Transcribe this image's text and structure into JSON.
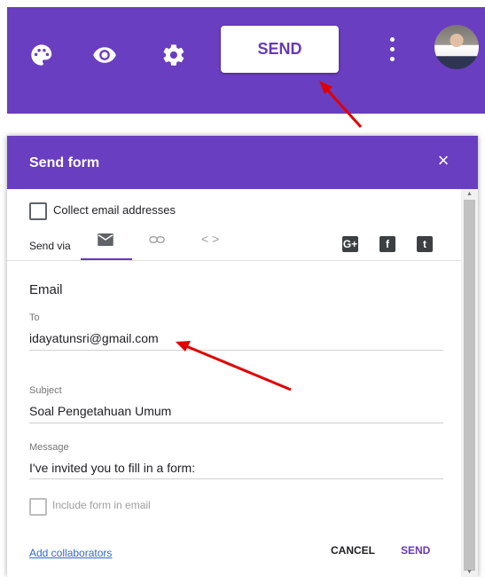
{
  "toolbar": {
    "send_label": "SEND",
    "icons": [
      "palette-icon",
      "eye-icon",
      "gear-icon",
      "more-vert-icon",
      "avatar"
    ],
    "background": "#6a3ec0"
  },
  "dialog": {
    "title": "Send form",
    "close": "×",
    "collect_email_label": "Collect email addresses",
    "send_via_label": "Send via",
    "tabs": [
      "mail-icon",
      "link-icon",
      "embed-icon"
    ],
    "social": {
      "gplus": "G+",
      "facebook": "f",
      "twitter": "t"
    },
    "section_title": "Email",
    "to_label": "To",
    "to_value": "idayatunsri@gmail.com",
    "subject_label": "Subject",
    "subject_value": "Soal Pengetahuan Umum",
    "message_label": "Message",
    "message_value": "I've invited you to fill in a form:",
    "include_form_label": "Include form in email",
    "add_collaborators": "Add collaborators",
    "cancel_label": "CANCEL",
    "send_label": "SEND",
    "accent": "#673ab7"
  }
}
